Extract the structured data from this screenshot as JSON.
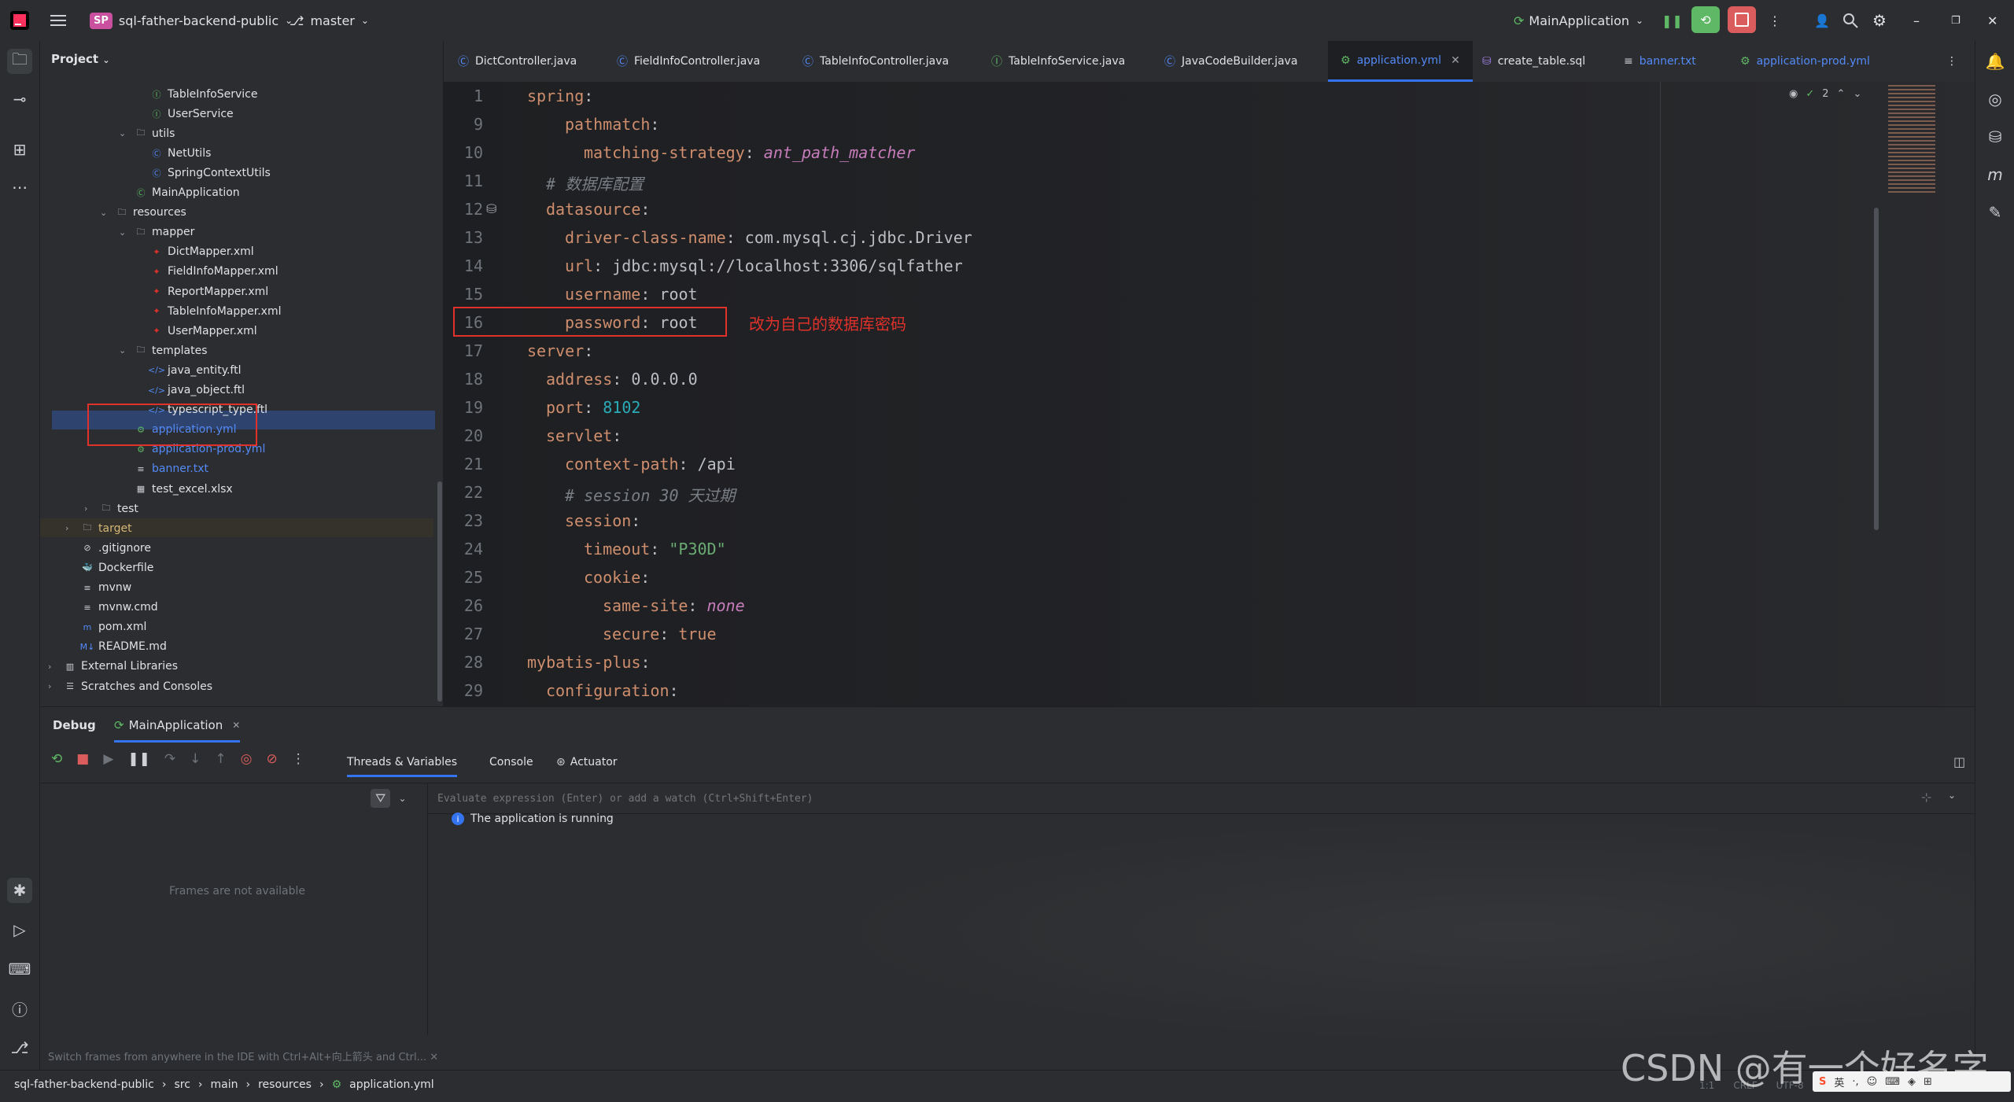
{
  "titlebar": {
    "project_badge": "SP",
    "project_name": "sql-father-backend-public",
    "branch": "master",
    "run_config": "MainApplication"
  },
  "project_panel": {
    "title": "Project",
    "tree": [
      {
        "label": "TableInfoService",
        "icon": "interface-icon"
      },
      {
        "label": "UserService",
        "icon": "interface-icon"
      },
      {
        "label": "utils",
        "icon": "folder-icon"
      },
      {
        "label": "NetUtils",
        "icon": "class-icon"
      },
      {
        "label": "SpringContextUtils",
        "icon": "class-icon"
      },
      {
        "label": "MainApplication",
        "icon": "spring-class-icon"
      },
      {
        "label": "resources",
        "icon": "folder-icon"
      },
      {
        "label": "mapper",
        "icon": "folder-icon"
      },
      {
        "label": "DictMapper.xml",
        "icon": "xml-icon"
      },
      {
        "label": "FieldInfoMapper.xml",
        "icon": "xml-icon"
      },
      {
        "label": "ReportMapper.xml",
        "icon": "xml-icon"
      },
      {
        "label": "TableInfoMapper.xml",
        "icon": "xml-icon"
      },
      {
        "label": "UserMapper.xml",
        "icon": "xml-icon"
      },
      {
        "label": "templates",
        "icon": "folder-icon"
      },
      {
        "label": "java_entity.ftl",
        "icon": "ftl-icon"
      },
      {
        "label": "java_object.ftl",
        "icon": "ftl-icon"
      },
      {
        "label": "typescript_type.ftl",
        "icon": "ftl-icon"
      },
      {
        "label": "application.yml",
        "icon": "yaml-icon"
      },
      {
        "label": "application-prod.yml",
        "icon": "yaml-icon"
      },
      {
        "label": "banner.txt",
        "icon": "text-icon"
      },
      {
        "label": "test_excel.xlsx",
        "icon": "table-icon"
      },
      {
        "label": "test",
        "icon": "folder-icon"
      },
      {
        "label": "target",
        "icon": "folder-icon"
      },
      {
        "label": ".gitignore",
        "icon": "gitignore-icon"
      },
      {
        "label": "Dockerfile",
        "icon": "docker-icon"
      },
      {
        "label": "mvnw",
        "icon": "text-icon"
      },
      {
        "label": "mvnw.cmd",
        "icon": "text-icon"
      },
      {
        "label": "pom.xml",
        "icon": "maven-icon"
      },
      {
        "label": "README.md",
        "icon": "markdown-icon"
      },
      {
        "label": "External Libraries",
        "icon": "library-icon"
      },
      {
        "label": "Scratches and Consoles",
        "icon": "scratches-icon"
      }
    ]
  },
  "editor_tabs": [
    {
      "label": "DictController.java"
    },
    {
      "label": "FieldInfoController.java"
    },
    {
      "label": "TableInfoController.java"
    },
    {
      "label": "TableInfoService.java"
    },
    {
      "label": "JavaCodeBuilder.java"
    },
    {
      "label": "application.yml"
    },
    {
      "label": "create_table.sql"
    },
    {
      "label": "banner.txt"
    },
    {
      "label": "application-prod.yml"
    }
  ],
  "editor": {
    "inspection_count": "2",
    "annotation": "改为自己的数据库密码",
    "lines": [
      {
        "num": "1"
      },
      {
        "num": "9"
      },
      {
        "num": "10"
      },
      {
        "num": "11"
      },
      {
        "num": "12"
      },
      {
        "num": "13"
      },
      {
        "num": "14"
      },
      {
        "num": "15"
      },
      {
        "num": "16"
      },
      {
        "num": "17"
      },
      {
        "num": "18"
      },
      {
        "num": "19"
      },
      {
        "num": "20"
      },
      {
        "num": "21"
      },
      {
        "num": "22"
      },
      {
        "num": "23"
      },
      {
        "num": "24"
      },
      {
        "num": "25"
      },
      {
        "num": "26"
      },
      {
        "num": "27"
      },
      {
        "num": "28"
      },
      {
        "num": "29"
      }
    ],
    "code": {
      "l1_key": "spring",
      "l9_key": "pathmatch",
      "l10_key": "matching-strategy",
      "l10_val": "ant_path_matcher",
      "l11_comment": "# 数据库配置",
      "l12_key": "datasource",
      "l13_key": "driver-class-name",
      "l13_val": "com.mysql.cj.jdbc.Driver",
      "l14_key": "url",
      "l14_val": "jdbc:mysql://localhost:3306/sqlfather",
      "l15_key": "username",
      "l15_val": "root",
      "l16_key": "password",
      "l16_val": "root",
      "l17_key": "server",
      "l18_key": "address",
      "l18_val": "0.0.0.0",
      "l19_key": "port",
      "l19_val": "8102",
      "l20_key": "servlet",
      "l21_key": "context-path",
      "l21_val": "/api",
      "l22_comment": "# session 30 天过期",
      "l23_key": "session",
      "l24_key": "timeout",
      "l24_val": "\"P30D\"",
      "l25_key": "cookie",
      "l26_key": "same-site",
      "l26_val": "none",
      "l27_key": "secure",
      "l27_val": "true",
      "l28_key": "mybatis-plus",
      "l29_key": "configuration"
    }
  },
  "debug": {
    "title": "Debug",
    "session_tab": "MainApplication",
    "subtabs": [
      "Threads & Variables",
      "Console",
      "Actuator"
    ],
    "eval_placeholder": "Evaluate expression (Enter) or add a watch (Ctrl+Shift+Enter)",
    "frames_empty": "Frames are not available",
    "running_msg": "The application is running",
    "hint": "Switch frames from anywhere in the IDE with Ctrl+Alt+向上箭头 and Ctrl..."
  },
  "statusbar": {
    "breadcrumb": [
      "sql-father-backend-public",
      "src",
      "main",
      "resources",
      "application.yml"
    ],
    "right": [
      "1:1",
      "CRLF",
      "UTF-8"
    ]
  },
  "watermark": "CSDN @有一个好名字",
  "colors": {
    "accent": "#3574f0",
    "red_box": "#e0312b",
    "run_green": "#5fb865",
    "stop_red": "#db5c5c",
    "selection": "#2e436e"
  }
}
